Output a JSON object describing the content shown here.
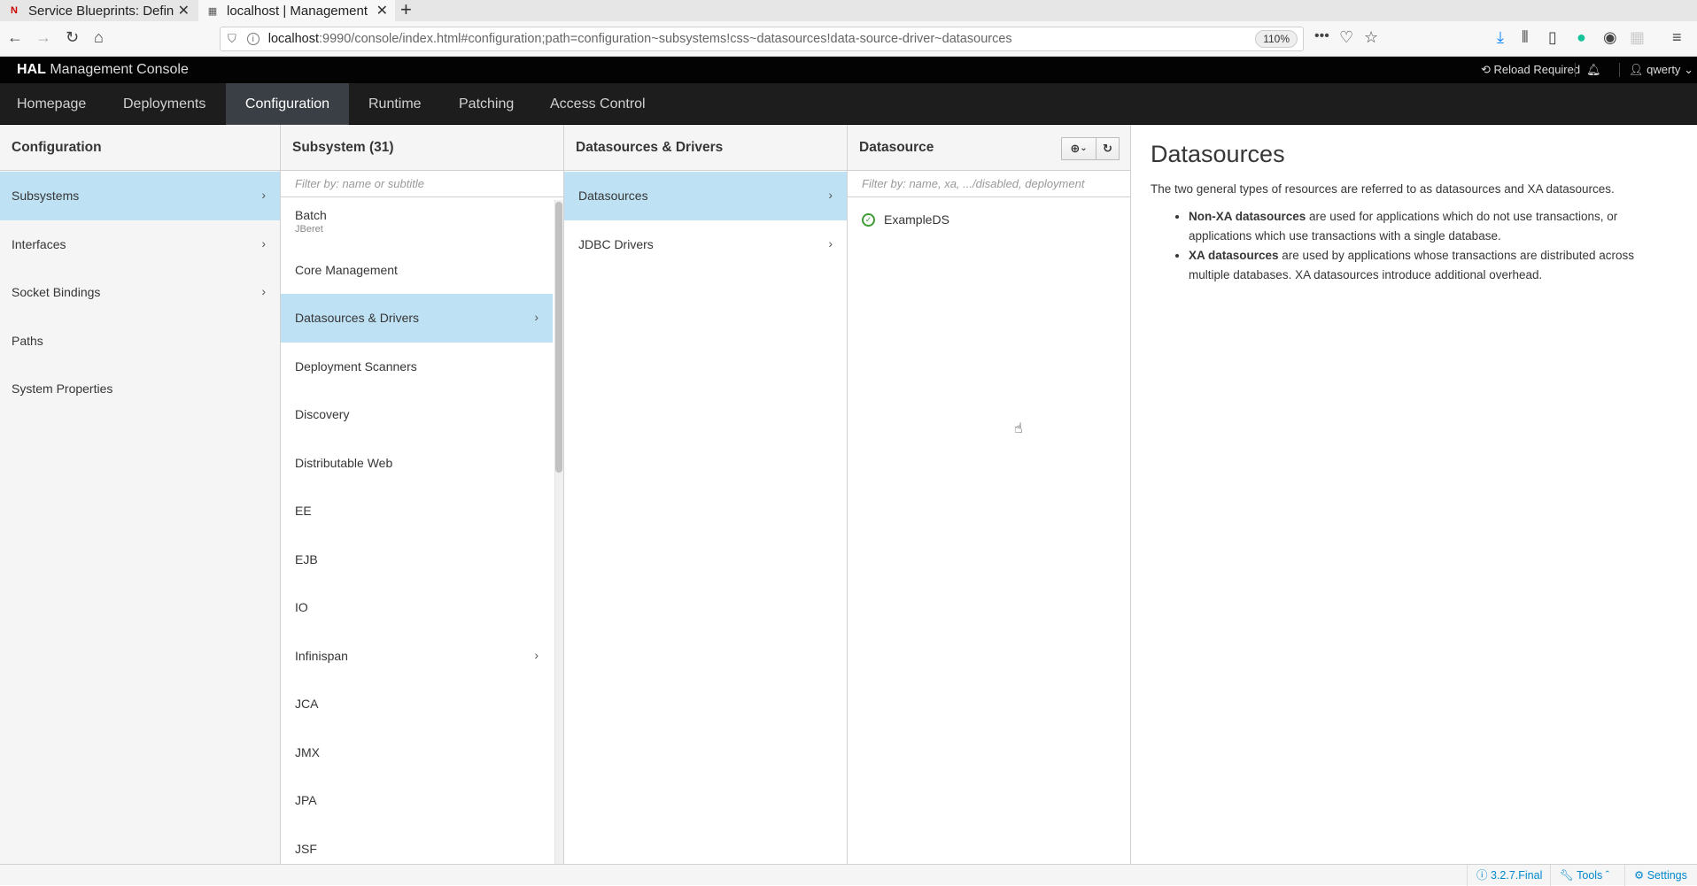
{
  "browser": {
    "tabs": [
      {
        "favicon": "N",
        "title": "Service Blueprints: Defin"
      },
      {
        "favicon": "▦",
        "title": "localhost | Management "
      }
    ],
    "url_host": "localhost",
    "url_rest": ":9990/console/index.html#configuration;path=configuration~subsystems!css~datasources!data-source-driver~datasources",
    "zoom": "110%"
  },
  "hal": {
    "brand_bold": "HAL",
    "brand_rest": "Management Console",
    "reload": "Reload Required",
    "user": "qwerty"
  },
  "nav": [
    "Homepage",
    "Deployments",
    "Configuration",
    "Runtime",
    "Patching",
    "Access Control"
  ],
  "col1": {
    "title": "Configuration",
    "items": [
      "Subsystems",
      "Interfaces",
      "Socket Bindings",
      "Paths",
      "System Properties"
    ]
  },
  "col2": {
    "title": "Subsystem (31)",
    "filter": "Filter by: name or subtitle",
    "items": [
      {
        "label": "Batch",
        "sub": "JBeret"
      },
      {
        "label": "Core Management",
        "sub": ""
      },
      {
        "label": "Datasources & Drivers",
        "sub": ""
      },
      {
        "label": "Deployment Scanners",
        "sub": ""
      },
      {
        "label": "Discovery",
        "sub": ""
      },
      {
        "label": "Distributable Web",
        "sub": ""
      },
      {
        "label": "EE",
        "sub": ""
      },
      {
        "label": "EJB",
        "sub": ""
      },
      {
        "label": "IO",
        "sub": ""
      },
      {
        "label": "Infinispan",
        "sub": ""
      },
      {
        "label": "JCA",
        "sub": ""
      },
      {
        "label": "JMX",
        "sub": ""
      },
      {
        "label": "JPA",
        "sub": ""
      },
      {
        "label": "JSF",
        "sub": ""
      }
    ]
  },
  "col3": {
    "title": "Datasources & Drivers",
    "items": [
      "Datasources",
      "JDBC Drivers"
    ]
  },
  "col4": {
    "title": "Datasource",
    "filter": "Filter by: name, xa, .../disabled, deployment",
    "items": [
      "ExampleDS"
    ]
  },
  "preview": {
    "title": "Datasources",
    "intro": "The two general types of resources are referred to as datasources and XA datasources.",
    "bullets": [
      {
        "bold": "Non-XA datasources",
        "text": " are used for applications which do not use transactions, or applications which use transactions with a single database."
      },
      {
        "bold": "XA datasources",
        "text": " are used by applications whose transactions are distributed across multiple databases. XA datasources introduce additional overhead."
      }
    ]
  },
  "footer": {
    "version": "3.2.7.Final",
    "tools": "Tools",
    "settings": "Settings"
  }
}
